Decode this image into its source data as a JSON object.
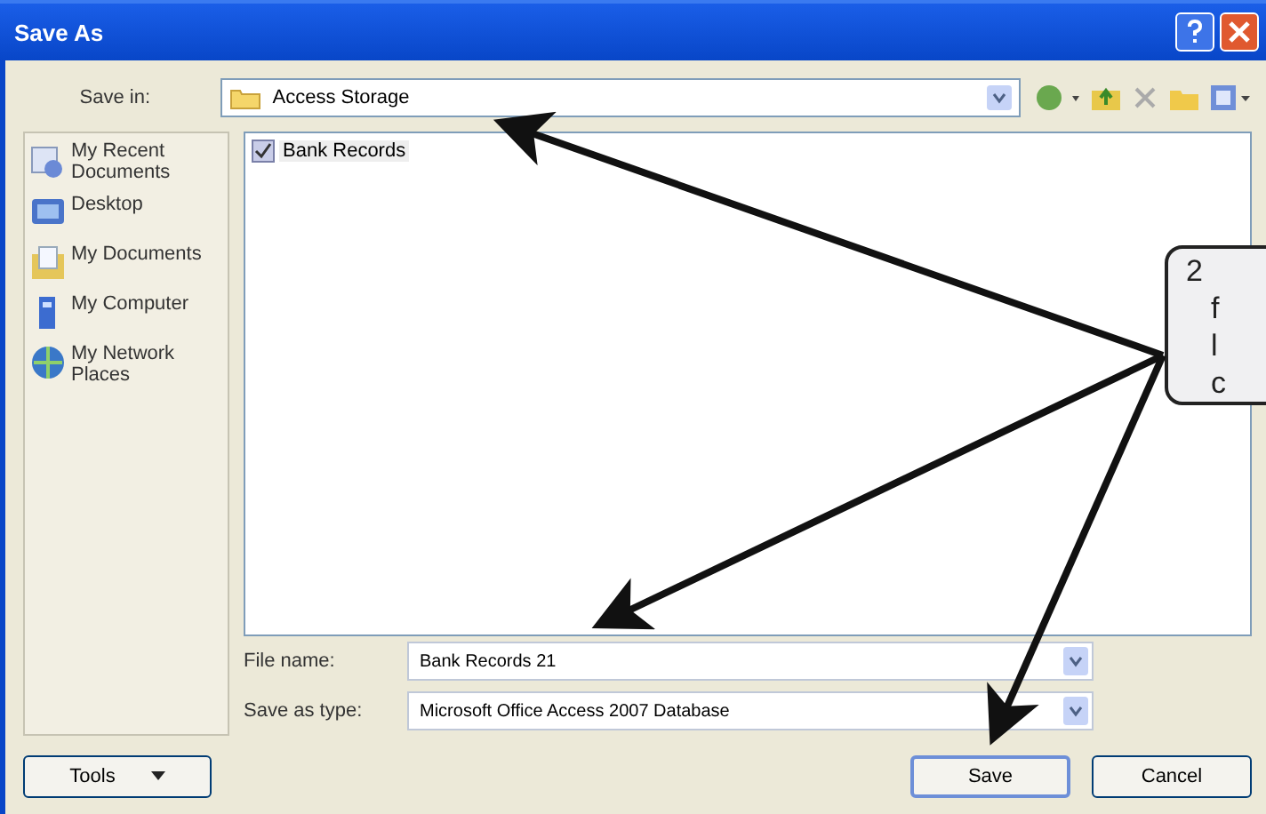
{
  "window": {
    "title": "Save As"
  },
  "save_in": {
    "label": "Save in:",
    "value": "Access Storage"
  },
  "places": [
    {
      "label": "My Recent Documents",
      "kind": "recent"
    },
    {
      "label": "Desktop",
      "kind": "desktop"
    },
    {
      "label": "My Documents",
      "kind": "documents"
    },
    {
      "label": "My Computer",
      "kind": "computer"
    },
    {
      "label": "My Network Places",
      "kind": "network"
    }
  ],
  "files": [
    {
      "name": "Bank Records"
    }
  ],
  "file_name": {
    "label": "File name:",
    "value": "Bank Records 21"
  },
  "save_as_type": {
    "label": "Save as type:",
    "value": "Microsoft Office Access 2007 Database"
  },
  "buttons": {
    "tools": "Tools",
    "save": "Save",
    "cancel": "Cancel"
  },
  "callout": {
    "lines": [
      "2",
      "f",
      "l",
      "c"
    ]
  }
}
